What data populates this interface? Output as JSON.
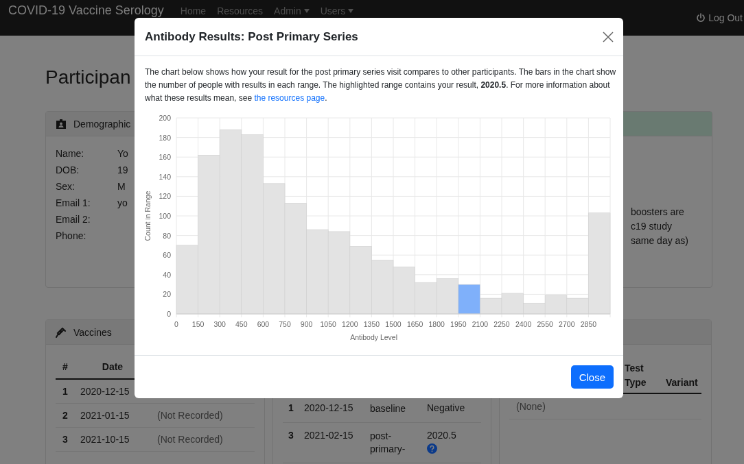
{
  "navbar": {
    "brand": "COVID-19 Vaccine Serology",
    "menu": [
      {
        "label": "Home",
        "dropdown": false
      },
      {
        "label": "Resources",
        "dropdown": false
      },
      {
        "label": "Admin",
        "dropdown": true
      },
      {
        "label": "Users",
        "dropdown": true
      }
    ],
    "logout": "Log Out"
  },
  "page_title": "Participan",
  "demographics": {
    "title": "Demographic",
    "fields": [
      {
        "label": "Name:",
        "value": "Yo"
      },
      {
        "label": "DOB:",
        "value": "19"
      },
      {
        "label": "Sex:",
        "value": "M"
      },
      {
        "label": "Email 1:",
        "value": "yo"
      },
      {
        "label": "Email 2:"
      },
      {
        "label": "Phone:"
      }
    ]
  },
  "notice": {
    "lines": [
      "boosters are",
      "c19 study",
      "same day as)"
    ]
  },
  "vaccines": {
    "title": "Vaccines",
    "columns": [
      "#",
      "Date"
    ],
    "rows": [
      {
        "number": "1",
        "date": "2020-12-15"
      },
      {
        "number": "2",
        "date": "2021-01-15",
        "column_3": "(Not Recorded)"
      },
      {
        "number": "3",
        "date": "2021-10-15",
        "column_3": "(Not Recorded)"
      }
    ]
  },
  "serology": {
    "rows": [
      {
        "number": "1",
        "date": "2020-12-15",
        "visit": "baseline",
        "result": "Negative",
        "help": false
      },
      {
        "number": "3",
        "date": "2021-02-15",
        "visit": "post-primary-",
        "result": "2020.5",
        "help": true
      }
    ]
  },
  "variants": {
    "columns": [
      "Test Type",
      "Variant"
    ],
    "rows": [
      {
        "column_1": "(None)"
      }
    ]
  },
  "modal": {
    "title": "Antibody Results: Post Primary Series",
    "intro": "The chart below shows how your result for the post primary series visit compares to other participants. The bars in the chart show the number of people with results in each range. The highlighted range contains your result, **2020.5**. For more information about what these results mean, see",
    "link": "the resources page",
    "after_link": ".",
    "chart_data": {
      "type": "bar",
      "xlabel": "Antibody Level",
      "ylabel": "Count in Range",
      "stacked": true,
      "grid": true,
      "categories": [
        "0",
        "150",
        "300",
        "450",
        "600",
        "750",
        "900",
        "1050",
        "1200",
        "1350",
        "1500",
        "1650",
        "1800",
        "1950",
        "2100",
        "2250",
        "2400",
        "2550",
        "2700",
        "2850"
      ],
      "series": [
        {
          "color": "#e3e3e3",
          "values": [
            70,
            162,
            188,
            183,
            133,
            113,
            86,
            84,
            69,
            55,
            48,
            32,
            36,
            null,
            16,
            21,
            11,
            19,
            16,
            103
          ]
        },
        {
          "color": "#7fb0fa",
          "values": [
            null,
            null,
            null,
            null,
            null,
            null,
            null,
            null,
            null,
            null,
            null,
            null,
            null,
            30,
            null,
            null,
            null,
            null,
            null,
            null
          ]
        }
      ],
      "ylim": [
        0,
        200
      ],
      "yticks": [
        0,
        20,
        40,
        60,
        80,
        100,
        120,
        140,
        160,
        180,
        200
      ]
    },
    "close_button": "Close"
  }
}
